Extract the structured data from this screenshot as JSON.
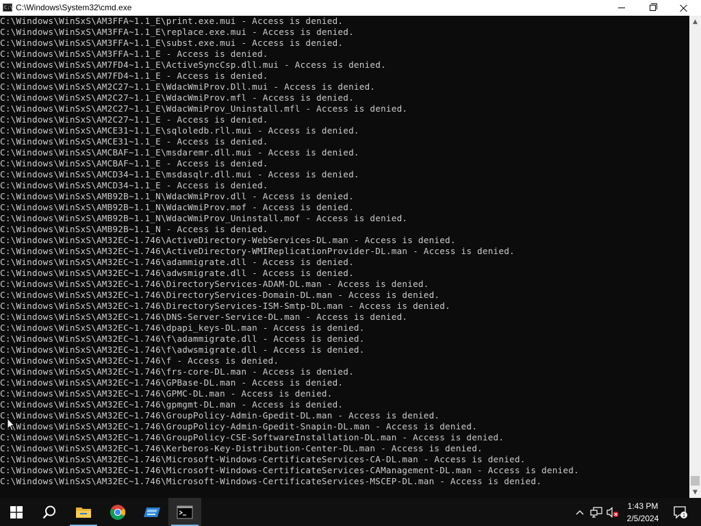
{
  "window": {
    "title": "C:\\Windows\\System32\\cmd.exe",
    "icon_label": "C:\\",
    "icons": {
      "minimize": "minimize-icon",
      "maximize": "maximize-icon",
      "close": "close-icon"
    }
  },
  "console": {
    "background": "#0c0c0c",
    "foreground": "#cccccc",
    "lines": [
      "C:\\Windows\\WinSxS\\AM3FFA~1.1_E\\print.exe.mui - Access is denied.",
      "C:\\Windows\\WinSxS\\AM3FFA~1.1_E\\replace.exe.mui - Access is denied.",
      "C:\\Windows\\WinSxS\\AM3FFA~1.1_E\\subst.exe.mui - Access is denied.",
      "C:\\Windows\\WinSxS\\AM3FFA~1.1_E - Access is denied.",
      "C:\\Windows\\WinSxS\\AM7FD4~1.1_E\\ActiveSyncCsp.dll.mui - Access is denied.",
      "C:\\Windows\\WinSxS\\AM7FD4~1.1_E - Access is denied.",
      "C:\\Windows\\WinSxS\\AM2C27~1.1_E\\WdacWmiProv.Dll.mui - Access is denied.",
      "C:\\Windows\\WinSxS\\AM2C27~1.1_E\\WdacWmiProv.mfl - Access is denied.",
      "C:\\Windows\\WinSxS\\AM2C27~1.1_E\\WdacWmiProv_Uninstall.mfl - Access is denied.",
      "C:\\Windows\\WinSxS\\AM2C27~1.1_E - Access is denied.",
      "C:\\Windows\\WinSxS\\AMCE31~1.1_E\\sqloledb.rll.mui - Access is denied.",
      "C:\\Windows\\WinSxS\\AMCE31~1.1_E - Access is denied.",
      "C:\\Windows\\WinSxS\\AMCBAF~1.1_E\\msdaremr.dll.mui - Access is denied.",
      "C:\\Windows\\WinSxS\\AMCBAF~1.1_E - Access is denied.",
      "C:\\Windows\\WinSxS\\AMCD34~1.1_E\\msdasqlr.dll.mui - Access is denied.",
      "C:\\Windows\\WinSxS\\AMCD34~1.1_E - Access is denied.",
      "C:\\Windows\\WinSxS\\AMB92B~1.1_N\\WdacWmiProv.dll - Access is denied.",
      "C:\\Windows\\WinSxS\\AMB92B~1.1_N\\WdacWmiProv.mof - Access is denied.",
      "C:\\Windows\\WinSxS\\AMB92B~1.1_N\\WdacWmiProv_Uninstall.mof - Access is denied.",
      "C:\\Windows\\WinSxS\\AMB92B~1.1_N - Access is denied.",
      "C:\\Windows\\WinSxS\\AM32EC~1.746\\ActiveDirectory-WebServices-DL.man - Access is denied.",
      "C:\\Windows\\WinSxS\\AM32EC~1.746\\ActiveDirectory-WMIReplicationProvider-DL.man - Access is denied.",
      "C:\\Windows\\WinSxS\\AM32EC~1.746\\adammigrate.dll - Access is denied.",
      "C:\\Windows\\WinSxS\\AM32EC~1.746\\adwsmigrate.dll - Access is denied.",
      "C:\\Windows\\WinSxS\\AM32EC~1.746\\DirectoryServices-ADAM-DL.man - Access is denied.",
      "C:\\Windows\\WinSxS\\AM32EC~1.746\\DirectoryServices-Domain-DL.man - Access is denied.",
      "C:\\Windows\\WinSxS\\AM32EC~1.746\\DirectoryServices-ISM-Smtp-DL.man - Access is denied.",
      "C:\\Windows\\WinSxS\\AM32EC~1.746\\DNS-Server-Service-DL.man - Access is denied.",
      "C:\\Windows\\WinSxS\\AM32EC~1.746\\dpapi_keys-DL.man - Access is denied.",
      "C:\\Windows\\WinSxS\\AM32EC~1.746\\f\\adammigrate.dll - Access is denied.",
      "C:\\Windows\\WinSxS\\AM32EC~1.746\\f\\adwsmigrate.dll - Access is denied.",
      "C:\\Windows\\WinSxS\\AM32EC~1.746\\f - Access is denied.",
      "C:\\Windows\\WinSxS\\AM32EC~1.746\\frs-core-DL.man - Access is denied.",
      "C:\\Windows\\WinSxS\\AM32EC~1.746\\GPBase-DL.man - Access is denied.",
      "C:\\Windows\\WinSxS\\AM32EC~1.746\\GPMC-DL.man - Access is denied.",
      "C:\\Windows\\WinSxS\\AM32EC~1.746\\gpmgmt-DL.man - Access is denied.",
      "C:\\Windows\\WinSxS\\AM32EC~1.746\\GroupPolicy-Admin-Gpedit-DL.man - Access is denied.",
      "C:\\Windows\\WinSxS\\AM32EC~1.746\\GroupPolicy-Admin-Gpedit-Snapin-DL.man - Access is denied.",
      "C:\\Windows\\WinSxS\\AM32EC~1.746\\GroupPolicy-CSE-SoftwareInstallation-DL.man - Access is denied.",
      "C:\\Windows\\WinSxS\\AM32EC~1.746\\Kerberos-Key-Distribution-Center-DL.man - Access is denied.",
      "C:\\Windows\\WinSxS\\AM32EC~1.746\\Microsoft-Windows-CertificateServices-CA-DL.man - Access is denied.",
      "C:\\Windows\\WinSxS\\AM32EC~1.746\\Microsoft-Windows-CertificateServices-CAManagement-DL.man - Access is denied.",
      "C:\\Windows\\WinSxS\\AM32EC~1.746\\Microsoft-Windows-CertificateServices-MSCEP-DL.man - Access is denied."
    ]
  },
  "taskbar": {
    "background": "#101010",
    "items": [
      {
        "name": "start-button",
        "icon": "windows-logo-icon"
      },
      {
        "name": "search-button",
        "icon": "search-icon"
      },
      {
        "name": "file-explorer-button",
        "icon": "folder-icon"
      },
      {
        "name": "chrome-button",
        "icon": "chrome-icon"
      },
      {
        "name": "server-manager-button",
        "icon": "server-manager-icon"
      },
      {
        "name": "cmd-taskbar-button",
        "icon": "cmd-icon",
        "active": true
      }
    ],
    "tray_icons": [
      "chevron-up-icon",
      "network-icon",
      "volume-muted-icon"
    ],
    "clock": {
      "time": "1:43 PM",
      "date": "2/5/2024"
    },
    "notification_count": "1"
  }
}
